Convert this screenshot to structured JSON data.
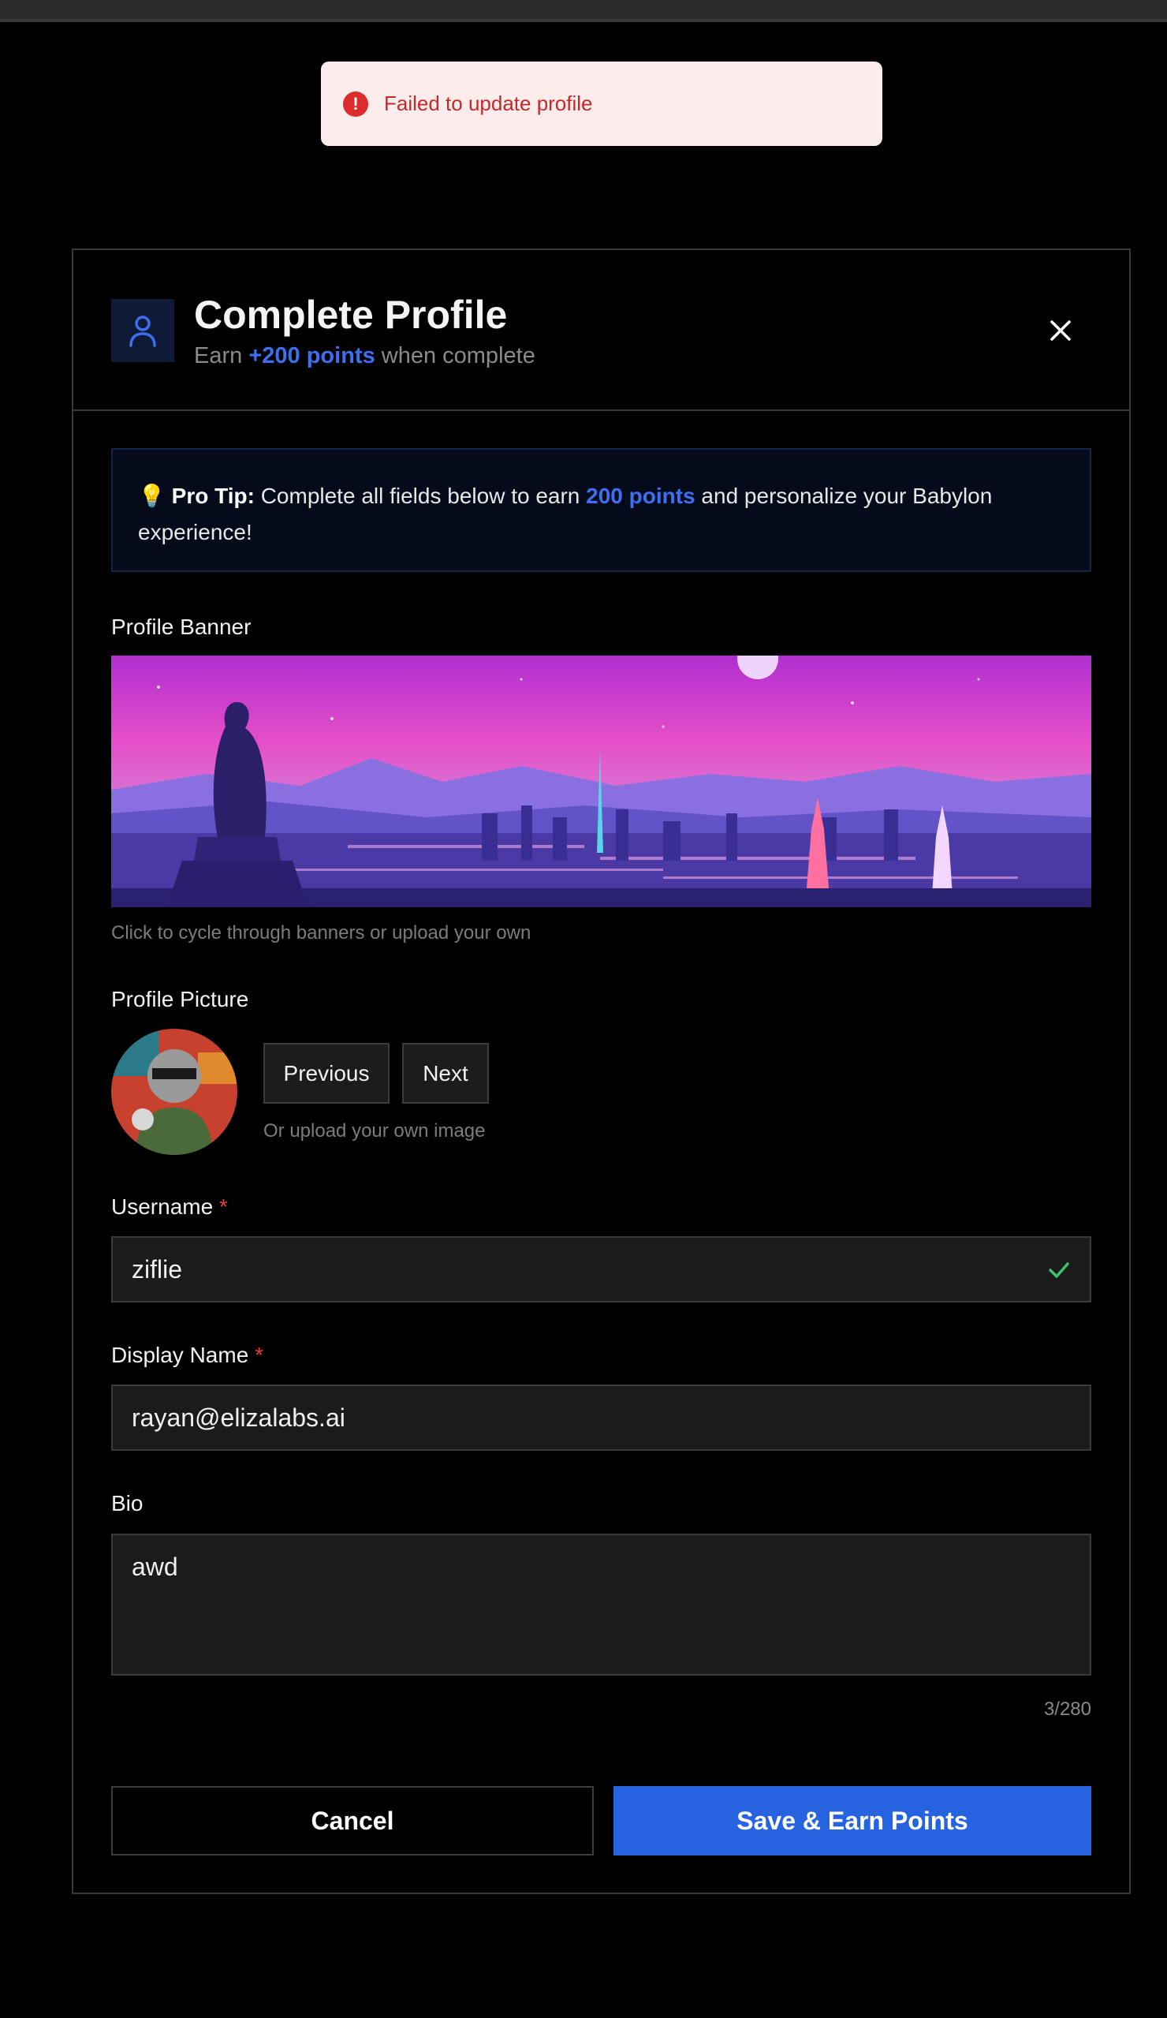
{
  "toast": {
    "message": "Failed to update profile",
    "icon": "error-icon",
    "color": "#dc2b2b"
  },
  "header": {
    "title": "Complete Profile",
    "subtitle_prefix": "Earn",
    "subtitle_points": "+200 points",
    "subtitle_suffix": "when complete",
    "icon": "user-icon"
  },
  "tip": {
    "emoji": "💡",
    "bold": "Pro Tip:",
    "text1": "Complete all fields below to earn",
    "points": "200 points",
    "text2": "and personalize your Babylon experience!"
  },
  "banner": {
    "label": "Profile Banner",
    "hint": "Click to cycle through banners or upload your own"
  },
  "picture": {
    "label": "Profile Picture",
    "previous": "Previous",
    "next": "Next",
    "hint": "Or upload your own image"
  },
  "username": {
    "label": "Username",
    "required": "*",
    "value": "ziflie",
    "valid_icon": "checkmark-icon"
  },
  "display_name": {
    "label": "Display Name",
    "required": "*",
    "value": "rayan@elizalabs.ai"
  },
  "bio": {
    "label": "Bio",
    "value": "awd",
    "counter": "3/280"
  },
  "actions": {
    "cancel": "Cancel",
    "save": "Save & Earn Points"
  },
  "colors": {
    "accent": "#2563e0",
    "error": "#dc2b2b",
    "success": "#3cc46a"
  }
}
